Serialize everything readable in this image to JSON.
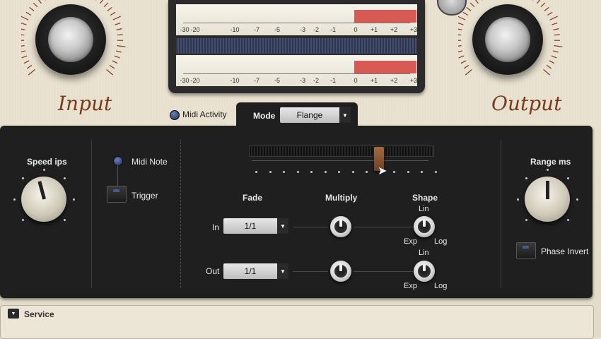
{
  "top": {
    "input_label": "Input",
    "output_label": "Output"
  },
  "meter": {
    "scale_labels": [
      "-30",
      "-20",
      "-10",
      "-7",
      "-5",
      "-3",
      "-2",
      "-1",
      "0",
      "+1",
      "+2",
      "+3"
    ]
  },
  "midi_activity": {
    "label": "Midi Activity"
  },
  "mode": {
    "label": "Mode",
    "value": "Flange"
  },
  "speed": {
    "label": "Speed ips"
  },
  "midi_note": {
    "label": "Midi Note"
  },
  "trigger": {
    "label": "Trigger"
  },
  "fade": {
    "header": "Fade",
    "in_label": "In",
    "in_value": "1/1",
    "out_label": "Out",
    "out_value": "1/1"
  },
  "multiply": {
    "header": "Multiply"
  },
  "shape": {
    "header": "Shape",
    "in": {
      "top": "Lin",
      "left": "Exp",
      "right": "Log"
    },
    "out": {
      "top": "Lin",
      "left": "Exp",
      "right": "Log"
    }
  },
  "range": {
    "label": "Range ms"
  },
  "phase_invert": {
    "label": "Phase Invert"
  },
  "service": {
    "label": "Service"
  },
  "colors": {
    "accent_copper": "#7a3a1c",
    "meter_red": "#d75a55",
    "panel_dark": "#1f1f1f"
  }
}
